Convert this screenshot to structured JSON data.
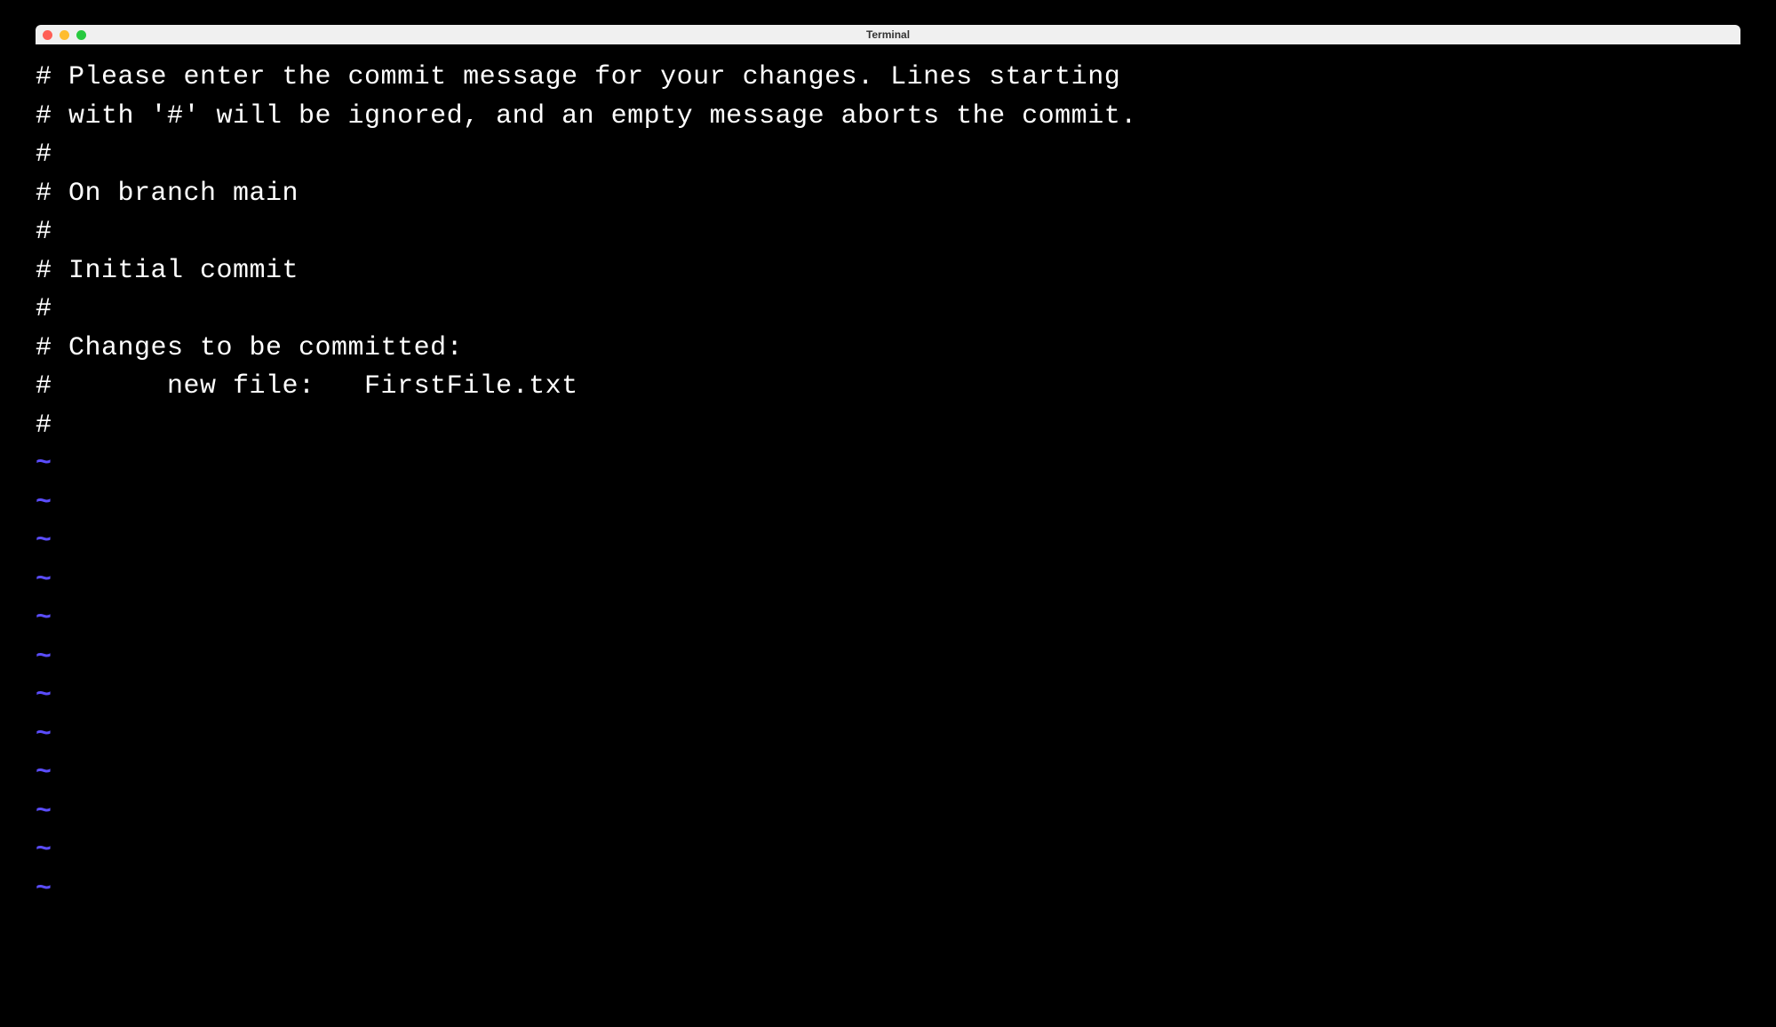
{
  "window": {
    "title": "Terminal"
  },
  "editor": {
    "lines": [
      "# Please enter the commit message for your changes. Lines starting",
      "# with '#' will be ignored, and an empty message aborts the commit.",
      "#",
      "# On branch main",
      "#",
      "# Initial commit",
      "#",
      "# Changes to be committed:",
      "#       new file:   FirstFile.txt",
      "#"
    ],
    "tilde_char": "~",
    "tilde_count": 12
  }
}
